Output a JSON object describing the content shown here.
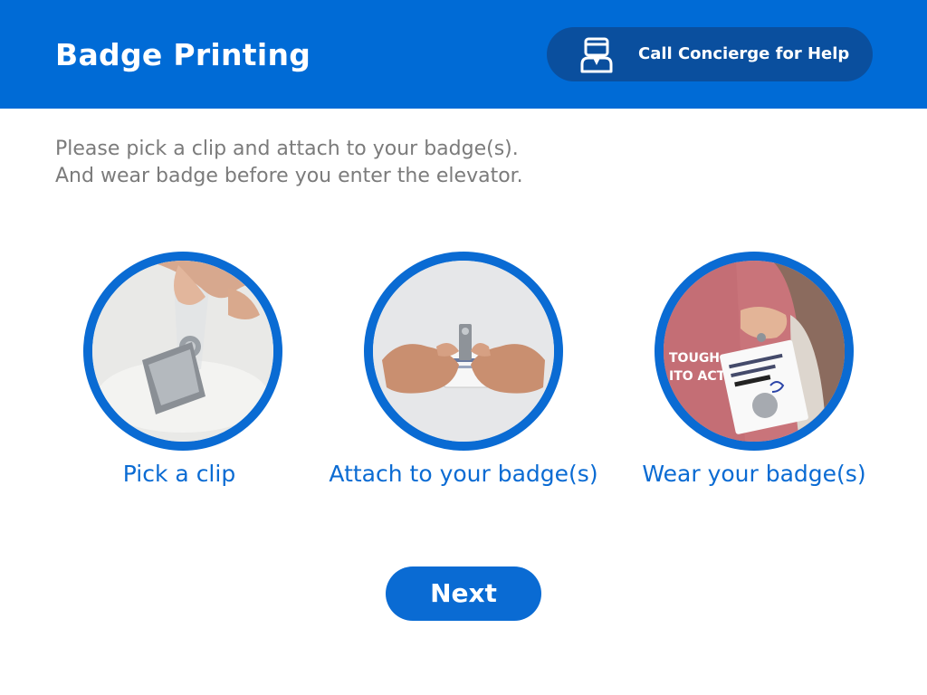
{
  "header": {
    "title": "Badge Printing",
    "concierge_label": "Call Concierge for Help",
    "background_color": "#006bd6",
    "concierge_button_color": "#0a4f9e",
    "concierge_icon": "concierge-person-icon"
  },
  "instructions": {
    "line1": "Please pick a clip and attach to your badge(s).",
    "line2": "And wear badge before you enter the elevator."
  },
  "steps": [
    {
      "label": "Pick a clip",
      "photo": "clip-photo"
    },
    {
      "label": "Attach to your badge(s)",
      "photo": "attach-clip-to-badge-photo"
    },
    {
      "label": "Wear your badge(s)",
      "photo": "wear-badge-photo"
    }
  ],
  "accent_color": "#0a6bd3",
  "next_label": "Next"
}
